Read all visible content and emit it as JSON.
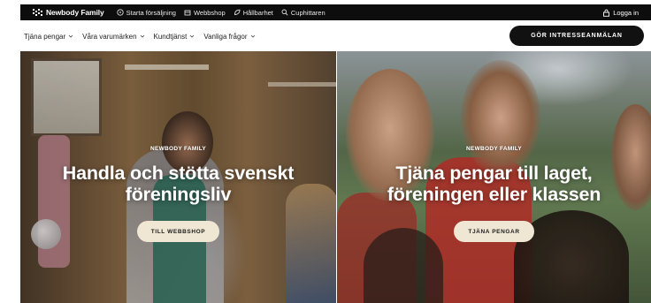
{
  "topbar": {
    "brand": "Newbody Family",
    "links": [
      {
        "label": "Starta försäljning",
        "icon": "rocket-icon"
      },
      {
        "label": "Webbshop",
        "icon": "shop-icon"
      },
      {
        "label": "Hållbarhet",
        "icon": "leaf-icon"
      },
      {
        "label": "Cuphittaren",
        "icon": "search-icon"
      }
    ],
    "login": "Logga in",
    "background": "#0d0d0d"
  },
  "mainnav": {
    "items": [
      {
        "label": "Tjäna pengar"
      },
      {
        "label": "Våra varumärken"
      },
      {
        "label": "Kundtjänst"
      },
      {
        "label": "Vanliga frågor"
      }
    ],
    "cta": "GÖR INTRESSEANMÄLAN"
  },
  "heroes": [
    {
      "eyebrow": "NEWBODY FAMILY",
      "headline_line1": "Handla och stötta svenskt",
      "headline_line2": "föreningsliv",
      "button": "TILL WEBBSHOP"
    },
    {
      "eyebrow": "NEWBODY FAMILY",
      "headline_line1": "Tjäna pengar till laget,",
      "headline_line2": "föreningen eller klassen",
      "button": "TJÄNA PENGAR"
    }
  ],
  "colors": {
    "button_bg": "#efe6d3",
    "cta_bg": "#111111"
  }
}
